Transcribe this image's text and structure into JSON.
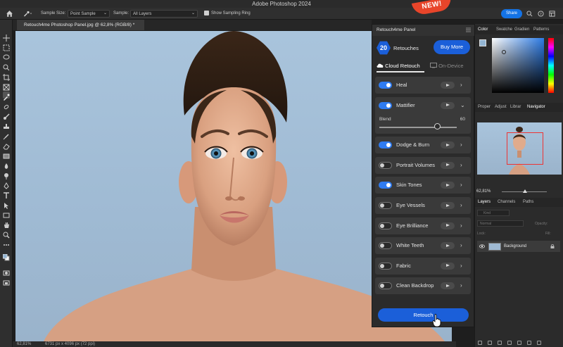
{
  "app": {
    "title": "Adobe Photoshop 2024"
  },
  "options_bar": {
    "sample_size_label": "Sample Size:",
    "sample_size_value": "Point Sample",
    "sample_label": "Sample:",
    "sample_value": "All Layers",
    "show_sampling_ring_label": "Show Sampling Ring",
    "show_sampling_ring_checked": true,
    "share_label": "Share"
  },
  "document": {
    "tab_title": "Retouch4me Photoshop Panel.jpg @ 62,8% (RGB/8) *"
  },
  "badge": {
    "text": "NEW!"
  },
  "retouch_panel": {
    "title": "Retouch4me Panel",
    "credits_count": "20",
    "credits_label": "Retouches",
    "buy_more_label": "Buy More",
    "mode_cloud": "Cloud Retouch",
    "mode_ondevice": "On-Device",
    "active_mode": "Cloud Retouch",
    "items": [
      {
        "label": "Heal",
        "enabled": true
      },
      {
        "label": "Mattifier",
        "enabled": true,
        "expanded": true,
        "blend_label": "Blend",
        "blend_value": "60"
      },
      {
        "label": "Dodge & Burn",
        "enabled": true
      },
      {
        "label": "Portrait Volumes",
        "enabled": false
      },
      {
        "label": "Skin Tones",
        "enabled": true
      },
      {
        "label": "Eye Vessels",
        "enabled": false
      },
      {
        "label": "Eye Brilliance",
        "enabled": false
      },
      {
        "label": "White Teeth",
        "enabled": false
      },
      {
        "label": "Fabric",
        "enabled": false
      },
      {
        "label": "Clean Backdrop",
        "enabled": false
      }
    ],
    "retouch_button_label": "Retouch"
  },
  "right_panels": {
    "color_tabs": [
      "Color",
      "Swatche",
      "Gradien",
      "Patterns"
    ],
    "active_color_tab": "Color",
    "nav_tabs": [
      "Proper",
      "Adjust",
      "Librar",
      "Navigator"
    ],
    "active_nav_tab": "Navigator",
    "navigator_zoom": "62,81%",
    "layers_tabs": [
      "Layers",
      "Channels",
      "Paths"
    ],
    "active_layers_tab": "Layers",
    "layer_kind_label": "Kind",
    "blend_mode": "Normal",
    "opacity_label": "Opacity:",
    "lock_label": "Lock:",
    "fill_label": "Fill:",
    "layer_name": "Background"
  },
  "status": {
    "zoom": "62,81%",
    "dimensions": "6731 px x 4096 px (72 ppi)"
  },
  "colors": {
    "accent_blue": "#1b5fd9",
    "share_blue": "#1473e6",
    "badge_red": "#e8452a",
    "backdrop": "#a9c4dc",
    "foreground_swatch": "#93b5d3"
  }
}
